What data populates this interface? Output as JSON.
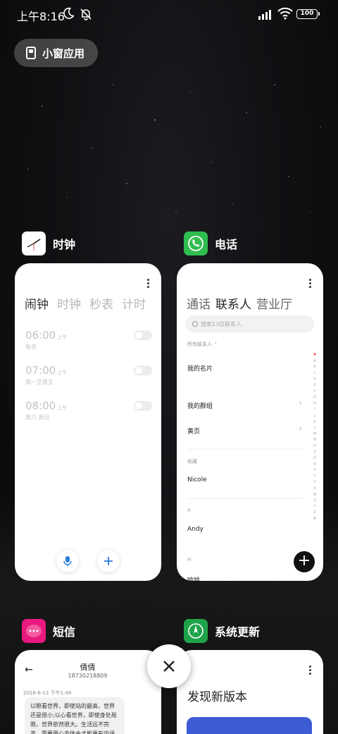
{
  "status_bar": {
    "time": "上午8:16",
    "battery": "100",
    "icons": [
      "moon-icon",
      "bell-muted-icon",
      "signal-icon",
      "wifi-icon",
      "battery-icon"
    ]
  },
  "floating_window_pill": {
    "label": "小窗应用",
    "icon": "window-icon"
  },
  "apps": {
    "clock": {
      "name": "时钟",
      "tabs": [
        "闹钟",
        "计时",
        "秒表",
        "计时"
      ],
      "tabs_display": [
        "闹钟",
        "时钟",
        "秒表",
        "计时"
      ],
      "alarms": [
        {
          "time": "06:00",
          "ampm": "上午",
          "repeat": "每天",
          "enabled": false
        },
        {
          "time": "07:00",
          "ampm": "上午",
          "repeat": "周一至周五",
          "enabled": false
        },
        {
          "time": "08:00",
          "ampm": "上午",
          "repeat": "周六 周日",
          "enabled": false
        }
      ],
      "buttons": [
        "microphone-icon",
        "plus-icon"
      ]
    },
    "phone": {
      "name": "电话",
      "tabs": [
        "通话",
        "联系人",
        "营业厅"
      ],
      "active_tab": "联系人",
      "search_placeholder": "搜索13位联系人",
      "filter_label": "所有联系人",
      "my_card": "我的名片",
      "my_groups": "我的群组",
      "yellow_pages": "黄页",
      "favorites_label": "收藏",
      "favorite_contact": "Nicole",
      "section_a": "A",
      "contact_a": "Andy",
      "section_h": "H",
      "contact_h": "哈哈",
      "index": [
        "A",
        "B",
        "C",
        "D",
        "E",
        "F",
        "G",
        "H",
        "I",
        "J",
        "K",
        "L",
        "M",
        "N",
        "O",
        "P",
        "Q",
        "R",
        "S",
        "T",
        "U",
        "V",
        "W",
        "X",
        "Y",
        "Z",
        "#"
      ]
    },
    "sms": {
      "name": "短信",
      "contact_name": "倩倩",
      "contact_number": "18730218809",
      "date": "2016-6-13 下午1:49",
      "message": "以眼看世界，即使站的最高，世界还是很小;以心看世界，即使身处局限，世界依然很大。生活远不完美，需要用心去体会才能更有内涵"
    },
    "system_update": {
      "name": "系统更新",
      "title": "发现新版本"
    }
  },
  "colors": {
    "phone_green": "#2fbd4f",
    "sms_pink": "#e8197f",
    "update_green": "#1fa34a",
    "update_banner": "#3d5bd4",
    "toggle_off": "#ececec"
  }
}
